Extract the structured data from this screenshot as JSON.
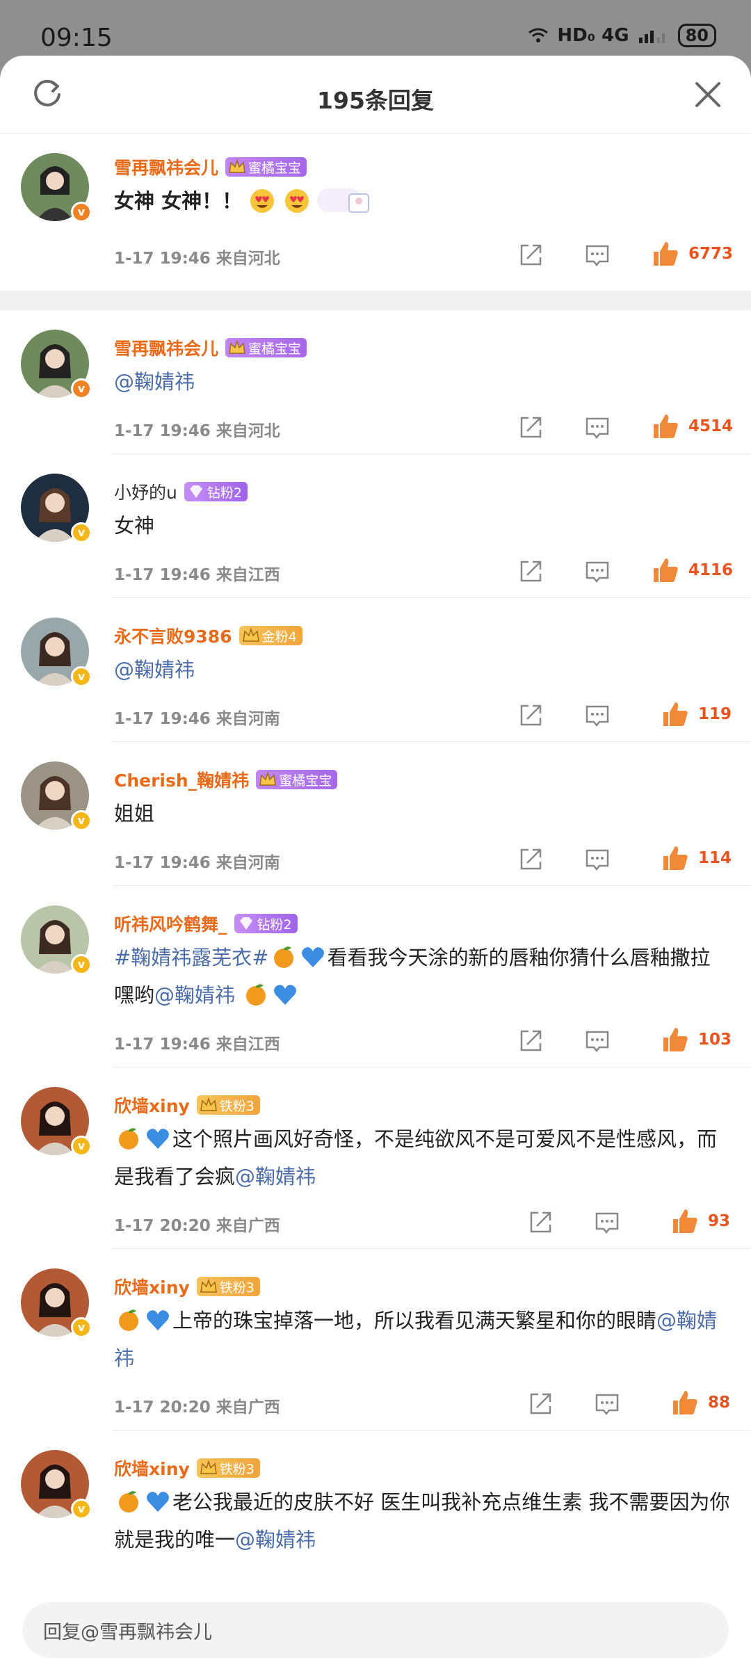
{
  "status_bar": {
    "time": "09:15",
    "network": "HD₀ 4G",
    "battery": "80"
  },
  "header": {
    "title": "195条回复"
  },
  "featured": {
    "name": "雪再飘祎会儿",
    "badge": "蜜橘宝宝",
    "text": "女神  女神！！",
    "time": "1-17  19:46  来自河北",
    "likes": "6773"
  },
  "comments": [
    {
      "name": "雪再飘祎会儿",
      "badge": "蜜橘宝宝",
      "badge_type": "purple",
      "name_style": "orange",
      "vbadge": "orange",
      "text": "",
      "mention": "@鞠婧祎",
      "time": "1-17  19:46  来自河北",
      "likes": "4514"
    },
    {
      "name": "小妤的u",
      "badge": "钻粉2",
      "badge_type": "diamond",
      "name_style": "plain",
      "vbadge": "yellow",
      "text": "女神",
      "mention": "",
      "time": "1-17  19:46  来自江西",
      "likes": "4116"
    },
    {
      "name": "永不言败9386",
      "badge": "金粉4",
      "badge_type": "orange",
      "name_style": "orange",
      "vbadge": "yellow",
      "text": "",
      "mention": "@鞠婧祎",
      "time": "1-17  19:46  来自河南",
      "likes": "119"
    },
    {
      "name": "Cherish_鞠婧祎",
      "badge": "蜜橘宝宝",
      "badge_type": "purple",
      "name_style": "orange",
      "vbadge": "yellow",
      "text": "姐姐",
      "mention": "",
      "time": "1-17  19:46  来自河南",
      "likes": "114"
    },
    {
      "name": "听祎风吟鹤舞_",
      "badge": "钻粉2",
      "badge_type": "diamond",
      "name_style": "orange",
      "vbadge": "yellow",
      "hashtag": "#鞠婧祎露芜衣#",
      "text": "看看我今天涂的新的唇釉你猜什么唇釉撒拉嘿哟",
      "mention": "@鞠婧祎",
      "time": "1-17  19:46  来自江西",
      "likes": "103"
    },
    {
      "name": "欣墙xiny",
      "badge": "铁粉3",
      "badge_type": "orange",
      "name_style": "orange",
      "vbadge": "yellow",
      "text": "这个照片画风好奇怪，不是纯欲风不是可爱风不是性感风，而是我看了会疯",
      "mention": "@鞠婧祎",
      "time": "1-17  20:20  来自广西",
      "likes": "93"
    },
    {
      "name": "欣墙xiny",
      "badge": "铁粉3",
      "badge_type": "orange",
      "name_style": "orange",
      "vbadge": "yellow",
      "text": "上帝的珠宝掉落一地，所以我看见满天繁星和你的眼睛",
      "mention": "@鞠婧祎",
      "time": "1-17  20:20  来自广西",
      "likes": "88"
    },
    {
      "name": "欣墙xiny",
      "badge": "铁粉3",
      "badge_type": "orange",
      "name_style": "orange",
      "vbadge": "yellow",
      "text": "老公我最近的皮肤不好 医生叫我补充点维生素 我不需要因为你就是我的唯一",
      "mention": "@鞠婧祎",
      "time": "",
      "likes": ""
    }
  ],
  "reply_bar": {
    "placeholder": "回复@雪再飘祎会儿"
  },
  "colors": {
    "accent": "#e86b1a",
    "like": "#e8541e",
    "mention": "#4b6ea8"
  }
}
